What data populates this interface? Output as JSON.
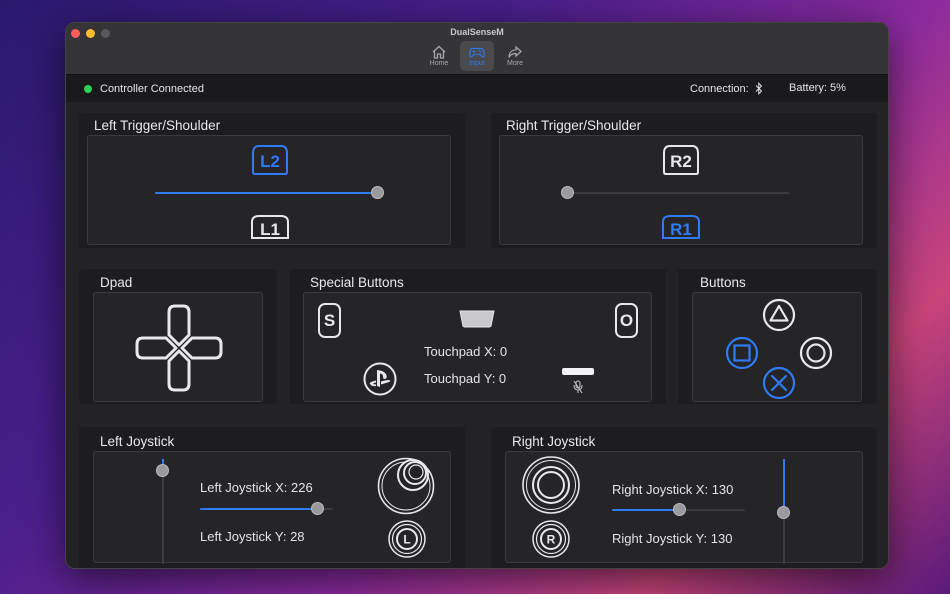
{
  "window": {
    "title": "DualSenseM"
  },
  "toolbar": [
    {
      "label": "Home",
      "icon": "house-icon"
    },
    {
      "label": "Input",
      "icon": "gamecontroller-icon",
      "active": true
    },
    {
      "label": "More",
      "icon": "arrow-share-icon"
    }
  ],
  "status": {
    "connected_text": "Controller Connected",
    "connection_label": "Connection:",
    "connection_icon": "bluetooth-icon",
    "battery_text": "Battery: 5%"
  },
  "left_trigger": {
    "title": "Left Trigger/Shoulder",
    "l2": "L2",
    "l1": "L1",
    "l2_value": 1.0,
    "l2_active": true,
    "l1_active": false
  },
  "right_trigger": {
    "title": "Right Trigger/Shoulder",
    "r2": "R2",
    "r1": "R1",
    "r2_value": 0.0,
    "r2_active": false,
    "r1_active": true
  },
  "dpad": {
    "title": "Dpad"
  },
  "special": {
    "title": "Special Buttons",
    "share": "S",
    "options": "O",
    "touchpad_x": "Touchpad X: 0",
    "touchpad_y": "Touchpad Y: 0"
  },
  "buttons": {
    "title": "Buttons",
    "active": [
      "square",
      "cross"
    ]
  },
  "left_joystick": {
    "title": "Left Joystick",
    "x_label": "Left Joystick X: 226",
    "y_label": "Left Joystick Y: 28",
    "x_value": 226,
    "y_value": 28,
    "l3": "L"
  },
  "right_joystick": {
    "title": "Right Joystick",
    "x_label": "Right Joystick X: 130",
    "y_label": "Right Joystick Y: 130",
    "x_value": 130,
    "y_value": 130,
    "r3": "R"
  },
  "colors": {
    "accent": "#2f7bf5",
    "connected": "#2fd158"
  }
}
